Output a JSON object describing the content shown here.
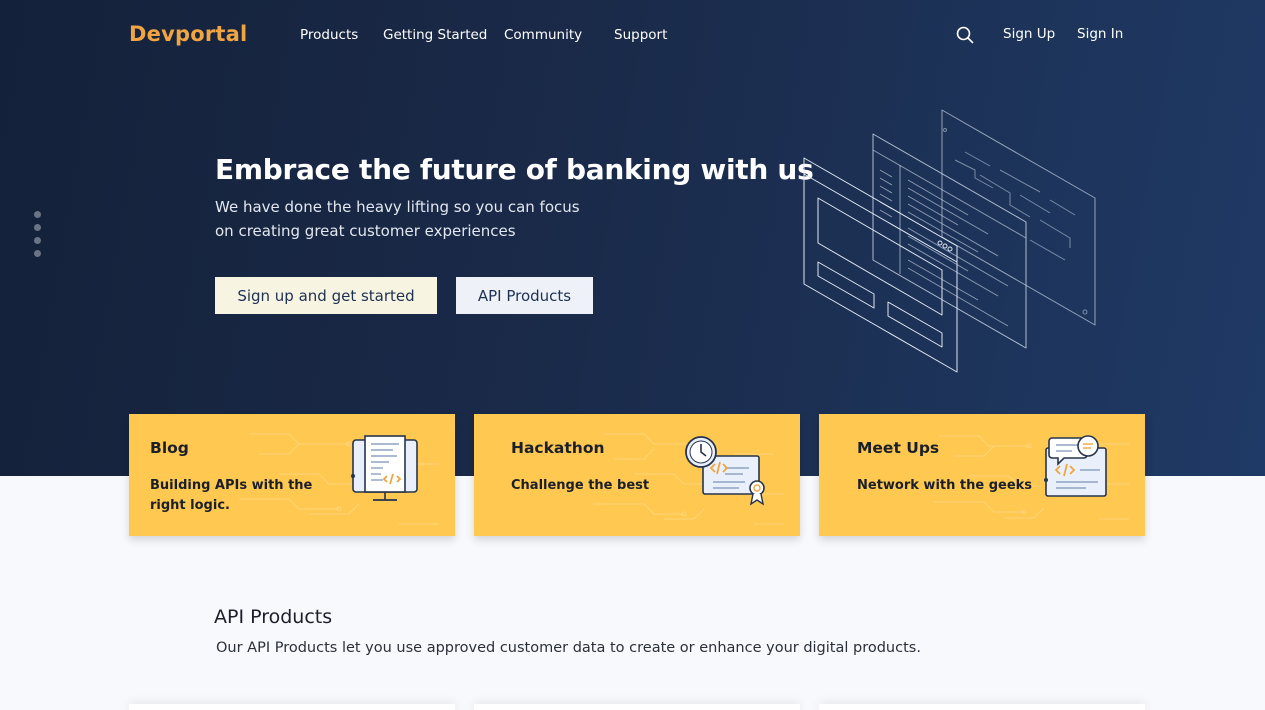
{
  "brand": {
    "logo": "Devportal",
    "logo_color": "#f0a541"
  },
  "nav": {
    "links": [
      "Products",
      "Getting Started",
      "Community",
      "Support"
    ],
    "search_icon": "search-icon",
    "sign_up": "Sign Up",
    "sign_in": "Sign In"
  },
  "hero": {
    "title": "Embrace the future of banking with us",
    "subtitle_line1": "We have done the heavy lifting so you can focus",
    "subtitle_line2": "on creating great customer experiences",
    "primary_button": "Sign up and get started",
    "secondary_button": "API Products",
    "background_color": "#1a2a49"
  },
  "cards": [
    {
      "title": "Blog",
      "desc_line1": "Building APIs with the",
      "desc_line2": "right logic.",
      "icon": "monitor-code-icon"
    },
    {
      "title": "Hackathon",
      "desc_line1": "Challenge the best",
      "desc_line2": "",
      "icon": "clock-certificate-icon"
    },
    {
      "title": "Meet Ups",
      "desc_line1": "Network with the geeks",
      "desc_line2": "",
      "icon": "chat-code-icon"
    }
  ],
  "card_color": "#ffc850",
  "section": {
    "title": "API Products",
    "description": "Our API Products let you use approved customer data to create or enhance your digital products."
  }
}
